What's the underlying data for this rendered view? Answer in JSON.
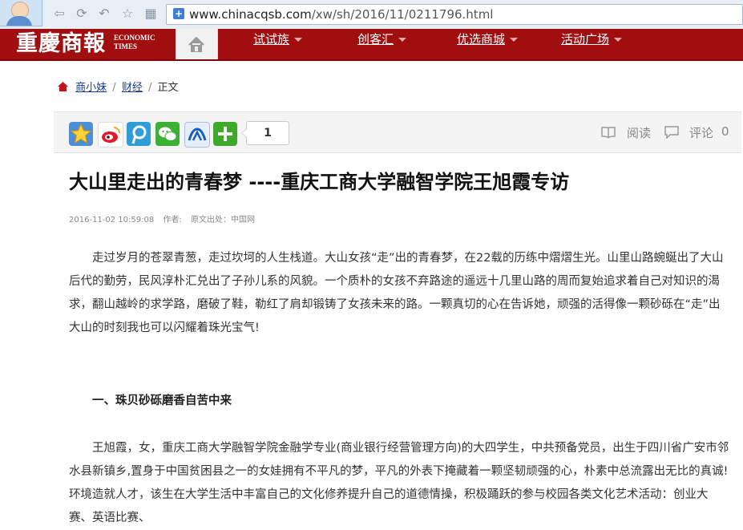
{
  "browser": {
    "url_host": "www.chinacqsb.com",
    "url_path": "/xw/sh/2016/11/0211796.html"
  },
  "site": {
    "logo_cn": "重慶商報",
    "logo_en_line1": "ECONOMIC",
    "logo_en_line2": "TIMES",
    "nav": [
      {
        "label": "试试族"
      },
      {
        "label": "创客汇"
      },
      {
        "label": "优选商城"
      },
      {
        "label": "活动广场"
      }
    ]
  },
  "breadcrumb": {
    "items": [
      "商小妹",
      "财经",
      "正文"
    ],
    "separator": "/"
  },
  "share": {
    "count": "1",
    "read_label": "阅读",
    "comment_label": "评论",
    "comment_count": "0"
  },
  "article": {
    "title": "大山里走出的青春梦 ----重庆工商大学融智学院王旭霞专访",
    "date": "2016-11-02 10:59:08",
    "author": "作者:",
    "source": "原文出处：中国网",
    "para1": "走过岁月的苍翠青葱，走过坎坷的人生栈道。大山女孩“走”出的青春梦，在22载的历练中熠熠生光。山里山路蜿蜒出了大山后代的勤劳，民风淳朴汇兑出了子孙儿系的风貌。一个质朴的女孩不弃路途的遥远十几里山路的周而复始追求着自己对知识的渴求，翻山越岭的求学路，磨破了鞋，勒红了肩却锻铸了女孩未来的路。一颗真切的心在告诉她，顽强的活得像一颗砂砾在“走”出大山的时刻我也可以闪耀着珠光宝气!",
    "subhead": "一、珠贝砂砾磨香自苦中来",
    "para2": "王旭霞，女，重庆工商大学融智学院金融学专业(商业银行经营管理方向)的大四学生，中共预备党员，出生于四川省广安市邻水县新镇乡,置身于中国贫困县之一的女娃拥有不平凡的梦，平凡的外表下掩藏着一颗坚韧顽强的心，朴素中总流露出无比的真诚!环境造就人才，该生在大学生活中丰富自己的文化修养提升自己的道德情操，积极踊跃的参与校园各类文化艺术活动：创业大赛、英语比赛、"
  },
  "colors": {
    "brand_red": "#a00e10",
    "link_blue": "#1a3c8f"
  }
}
